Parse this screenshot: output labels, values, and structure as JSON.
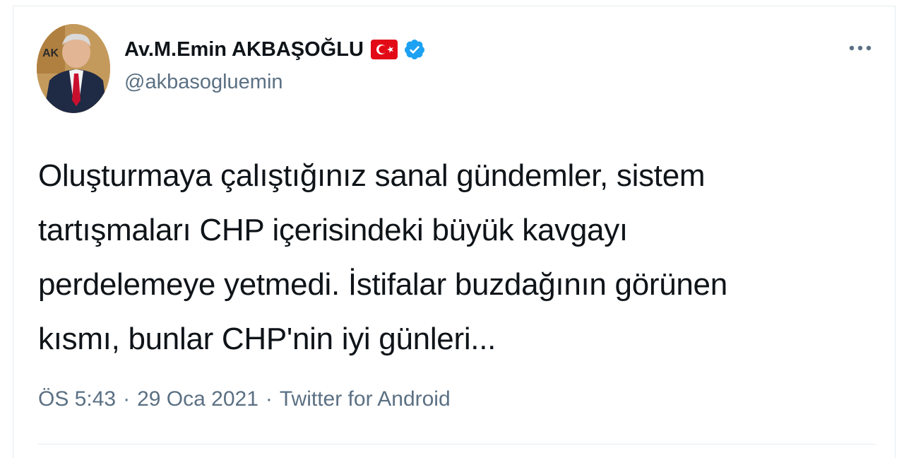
{
  "tweet": {
    "author": {
      "display_name": "Av.M.Emin AKBAŞOĞLU",
      "handle": "@akbasogluemin",
      "flag_icon": "turkey-flag-icon",
      "verified_icon": "verified-badge-icon",
      "avatar_icon": "profile-photo",
      "avatar_sign_text": "AK"
    },
    "more_icon": "more-options-icon",
    "text_lines": [
      "Oluşturmaya çalıştığınız sanal gündemler, sistem",
      "tartışmaları CHP içerisindeki büyük kavgayı",
      "perdelemeye yetmedi. İstifalar buzdağının görünen",
      "kısmı, bunlar CHP'nin iyi günleri..."
    ],
    "time": "ÖS 5:43",
    "separator": "·",
    "date": "29 Oca 2021",
    "source": "Twitter for Android"
  },
  "colors": {
    "text_primary": "#0f1419",
    "text_secondary": "#5b7083",
    "verified_blue": "#1da1f2",
    "flag_red": "#e30a17",
    "border": "#e6ecf0"
  }
}
